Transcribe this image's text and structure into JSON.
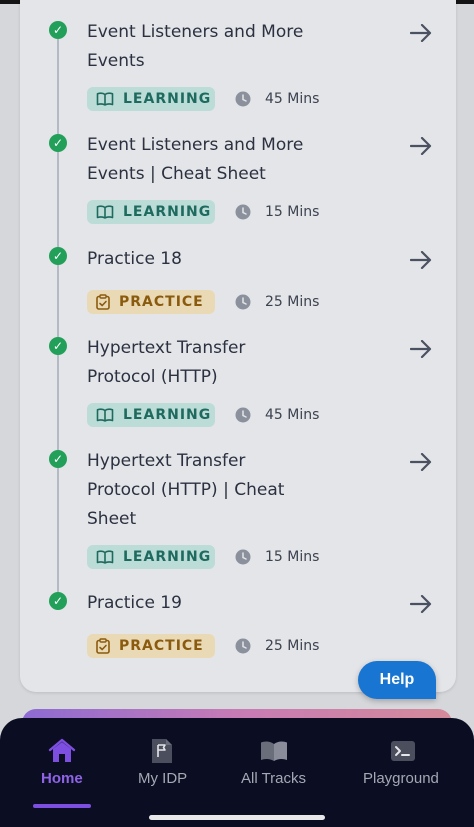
{
  "items": [
    {
      "title_lines": [
        "Event Listeners and More",
        "Events"
      ],
      "badge": "LEARNING",
      "badge_kind": "learning",
      "duration": "45 Mins"
    },
    {
      "title_lines": [
        "Event Listeners and More",
        "Events | Cheat Sheet"
      ],
      "badge": "LEARNING",
      "badge_kind": "learning",
      "duration": "15 Mins"
    },
    {
      "title_lines": [
        "Practice 18"
      ],
      "badge": "PRACTICE",
      "badge_kind": "practice",
      "duration": "25 Mins"
    },
    {
      "title_lines": [
        "Hypertext Transfer",
        "Protocol (HTTP)"
      ],
      "badge": "LEARNING",
      "badge_kind": "learning",
      "duration": "45 Mins"
    },
    {
      "title_lines": [
        "Hypertext Transfer",
        "Protocol (HTTP) | Cheat",
        "Sheet"
      ],
      "badge": "LEARNING",
      "badge_kind": "learning",
      "duration": "15 Mins"
    },
    {
      "title_lines": [
        "Practice 19"
      ],
      "badge": "PRACTICE",
      "badge_kind": "practice",
      "duration": "25 Mins"
    }
  ],
  "help_label": "Help",
  "nav": [
    {
      "label": "Home",
      "icon": "home-icon",
      "active": true
    },
    {
      "label": "My IDP",
      "icon": "flag-document-icon",
      "active": false
    },
    {
      "label": "All Tracks",
      "icon": "open-book-icon",
      "active": false
    },
    {
      "label": "Playground",
      "icon": "terminal-icon",
      "active": false
    }
  ],
  "colors": {
    "check": "#22a05a",
    "learning_bg": "#bcdcd8",
    "learning_fg": "#1e6a5e",
    "practice_bg": "#ead9b5",
    "practice_fg": "#8a5a0e",
    "help": "#1875d1",
    "nav_bg": "#0b0e22",
    "nav_active": "#8e63e8"
  }
}
